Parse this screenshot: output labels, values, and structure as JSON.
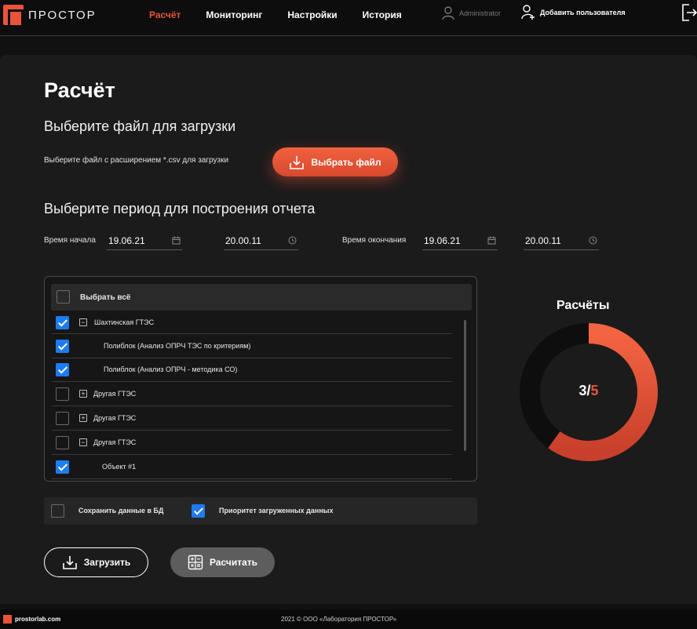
{
  "brand": {
    "name": "ПРОСТОР"
  },
  "nav": [
    {
      "label": "Расчёт",
      "active": true
    },
    {
      "label": "Мониторинг",
      "active": false
    },
    {
      "label": "Настройки",
      "active": false
    },
    {
      "label": "История",
      "active": false
    }
  ],
  "user": {
    "name": "Administrator",
    "add_label": "Добавить пользователя"
  },
  "page": {
    "title": "Расчёт",
    "file_heading": "Выберите файл для загрузки",
    "file_hint": "Выберите файл с расширением *.csv для загрузки",
    "file_button": "Выбрать файл",
    "period_heading": "Выберите период для построения отчета"
  },
  "period": {
    "start_label": "Время начала",
    "start_date": "19.06.21",
    "start_time": "20.00.11",
    "end_label": "Время окончания",
    "end_date": "19.06.21",
    "end_time": "20.00.11"
  },
  "tree": {
    "select_all": "Выбрать всё",
    "items": [
      {
        "label": "Шахтинская ГТЭС",
        "checked": true,
        "toggle": "−"
      },
      {
        "label": "Полиблок (Анализ ОПРЧ ТЭС по критериям)",
        "checked": true,
        "toggle": ""
      },
      {
        "label": "Полиблок (Анализ ОПРЧ - методика СО)",
        "checked": true,
        "toggle": ""
      },
      {
        "label": "Другая ГТЭС",
        "checked": false,
        "toggle": "+"
      },
      {
        "label": "Другая ГТЭС",
        "checked": false,
        "toggle": "+"
      },
      {
        "label": "Другая ГТЭС",
        "checked": false,
        "toggle": "−"
      },
      {
        "label": "Объект #1",
        "checked": true,
        "toggle": ""
      }
    ]
  },
  "options": {
    "save_db": {
      "label": "Сохранить данные в БД",
      "checked": false
    },
    "priority": {
      "label": "Приоритет загруженных данных",
      "checked": true
    }
  },
  "actions": {
    "upload": "Загрузить",
    "calculate": "Расчитать"
  },
  "progress": {
    "title": "Расчёты",
    "done": "3",
    "total": "5",
    "fraction": 0.6
  },
  "colors": {
    "accent": "#e8533a",
    "check": "#1e7cf2",
    "panel": "#1b1b1b"
  },
  "footer": {
    "site": "prostorlab.com",
    "copyright": "2021 © ООО «Лаборатория ПРОСТОР»"
  }
}
